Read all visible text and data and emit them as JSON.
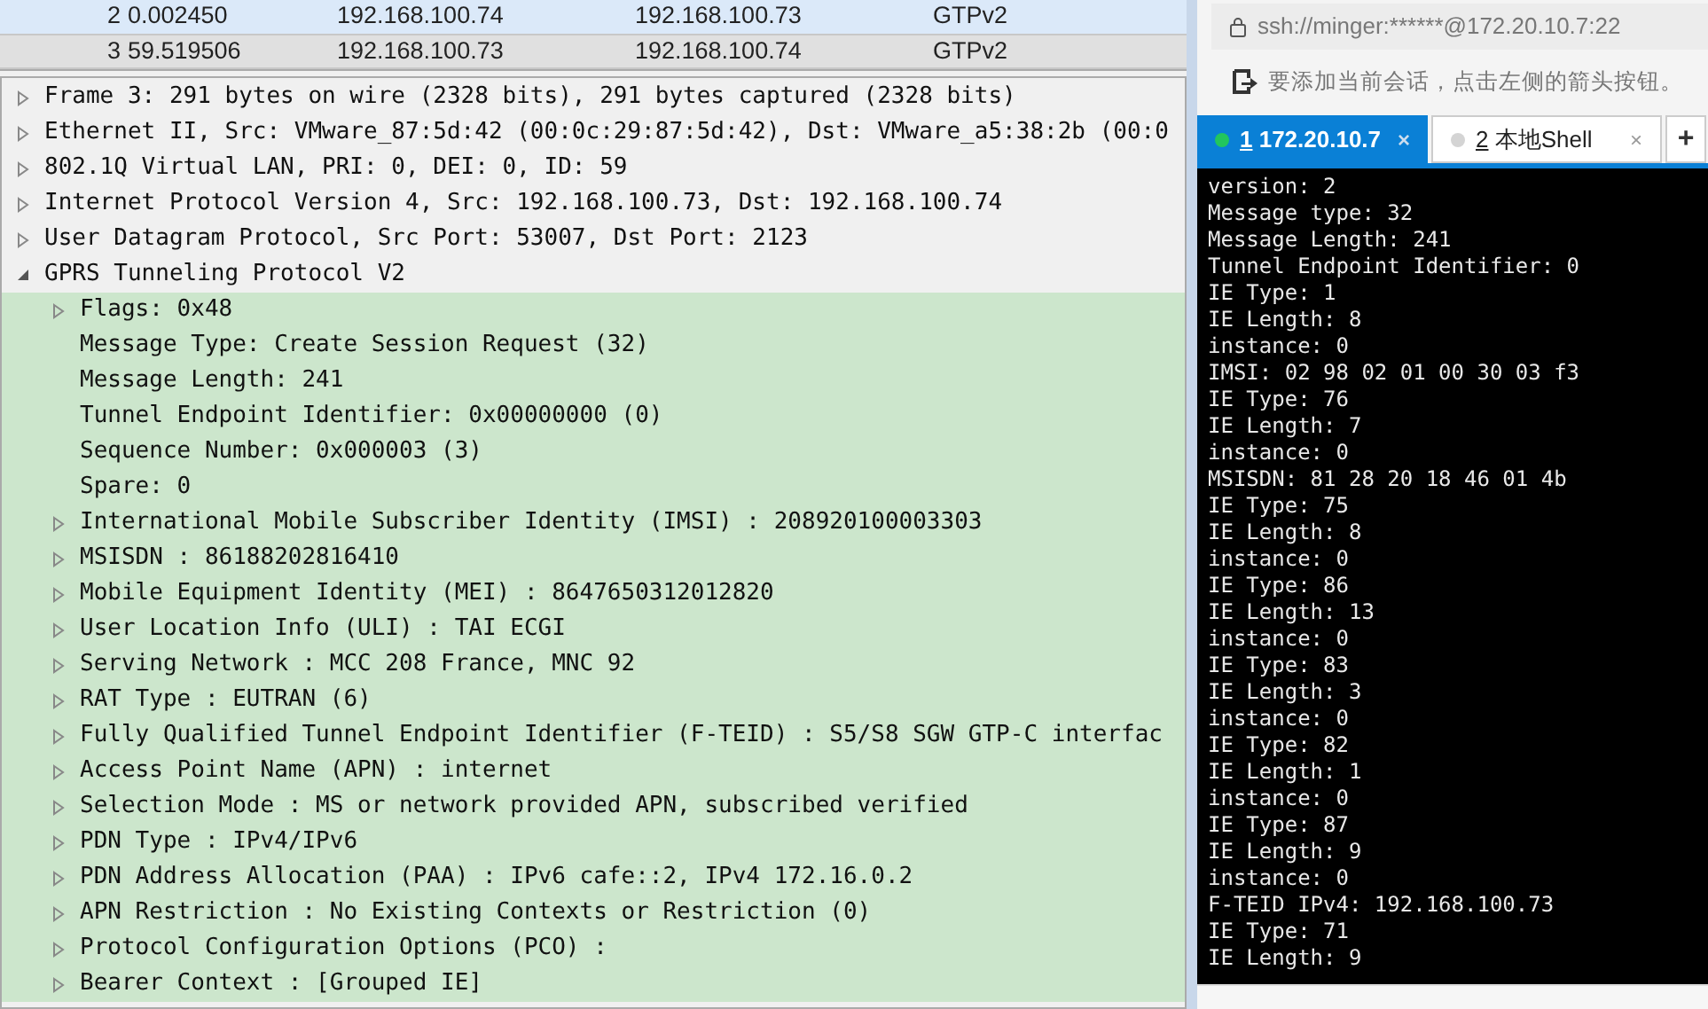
{
  "packet_list": {
    "rows": [
      {
        "no": "2",
        "time": "0.002450",
        "source": "192.168.100.74",
        "destination": "192.168.100.73",
        "protocol": "GTPv2",
        "selected": false
      },
      {
        "no": "3",
        "time": "59.519506",
        "source": "192.168.100.73",
        "destination": "192.168.100.74",
        "protocol": "GTPv2",
        "selected": true
      }
    ]
  },
  "packet_details": [
    {
      "text": "Frame 3: 291 bytes on wire (2328 bits), 291 bytes captured (2328 bits)",
      "kind": "node",
      "expanded": false
    },
    {
      "text": "Ethernet II, Src: VMware_87:5d:42 (00:0c:29:87:5d:42), Dst: VMware_a5:38:2b (00:0",
      "kind": "node",
      "expanded": false
    },
    {
      "text": "802.1Q Virtual LAN, PRI: 0, DEI: 0, ID: 59",
      "kind": "node",
      "expanded": false
    },
    {
      "text": "Internet Protocol Version 4, Src: 192.168.100.73, Dst: 192.168.100.74",
      "kind": "node",
      "expanded": false
    },
    {
      "text": "User Datagram Protocol, Src Port: 53007, Dst Port: 2123",
      "kind": "node",
      "expanded": false
    },
    {
      "text": "GPRS Tunneling Protocol V2",
      "kind": "node",
      "expanded": true,
      "children": [
        {
          "text": "Flags: 0x48",
          "kind": "node",
          "expanded": false
        },
        {
          "text": "Message Type: Create Session Request (32)",
          "kind": "leaf"
        },
        {
          "text": "Message Length: 241",
          "kind": "leaf"
        },
        {
          "text": "Tunnel Endpoint Identifier: 0x00000000 (0)",
          "kind": "leaf"
        },
        {
          "text": "Sequence Number: 0x000003 (3)",
          "kind": "leaf"
        },
        {
          "text": "Spare: 0",
          "kind": "leaf"
        },
        {
          "text": "International Mobile Subscriber Identity (IMSI) : 208920100003303",
          "kind": "node",
          "expanded": false
        },
        {
          "text": "MSISDN : 86188202816410",
          "kind": "node",
          "expanded": false
        },
        {
          "text": "Mobile Equipment Identity (MEI) : 8647650312012820",
          "kind": "node",
          "expanded": false
        },
        {
          "text": "User Location Info (ULI) : TAI ECGI",
          "kind": "node",
          "expanded": false
        },
        {
          "text": "Serving Network : MCC 208 France, MNC 92",
          "kind": "node",
          "expanded": false
        },
        {
          "text": "RAT Type : EUTRAN (6)",
          "kind": "node",
          "expanded": false
        },
        {
          "text": "Fully Qualified Tunnel Endpoint Identifier (F-TEID) : S5/S8 SGW GTP-C interfac",
          "kind": "node",
          "expanded": false
        },
        {
          "text": "Access Point Name (APN) : internet",
          "kind": "node",
          "expanded": false
        },
        {
          "text": "Selection Mode : MS or network provided APN, subscribed verified",
          "kind": "node",
          "expanded": false
        },
        {
          "text": "PDN Type : IPv4/IPv6",
          "kind": "node",
          "expanded": false
        },
        {
          "text": "PDN Address Allocation (PAA) : IPv6 cafe::2, IPv4 172.16.0.2",
          "kind": "node",
          "expanded": false
        },
        {
          "text": "APN Restriction : No Existing Contexts or Restriction (0)",
          "kind": "node",
          "expanded": false
        },
        {
          "text": "Protocol Configuration Options (PCO) :",
          "kind": "node",
          "expanded": false
        },
        {
          "text": "Bearer Context : [Grouped IE]",
          "kind": "node",
          "expanded": false
        }
      ]
    }
  ],
  "terminal_app": {
    "address": "ssh://minger:******@172.20.10.7:22",
    "hint": "要添加当前会话，点击左侧的箭头按钮。",
    "tabs": [
      {
        "number": "1",
        "label": " 172.20.10.7",
        "selected": true,
        "close": "×"
      },
      {
        "number": "2",
        "label": " 本地Shell",
        "selected": false,
        "close": "×"
      }
    ],
    "new_tab": "+",
    "output": [
      "version: 2",
      "Message type: 32",
      "Message Length: 241",
      "Tunnel Endpoint Identifier: 0",
      "IE Type: 1",
      "IE Length: 8",
      "instance: 0",
      "IMSI: 02 98 02 01 00 30 03 f3",
      "IE Type: 76",
      "IE Length: 7",
      "instance: 0",
      "MSISDN: 81 28 20 18 46 01 4b",
      "IE Type: 75",
      "IE Length: 8",
      "instance: 0",
      "IE Type: 86",
      "IE Length: 13",
      "instance: 0",
      "IE Type: 83",
      "IE Length: 3",
      "instance: 0",
      "IE Type: 82",
      "IE Length: 1",
      "instance: 0",
      "IE Type: 87",
      "IE Length: 9",
      "instance: 0",
      "F-TEID IPv4: 192.168.100.73",
      "IE Type: 71",
      "IE Length: 9"
    ]
  }
}
